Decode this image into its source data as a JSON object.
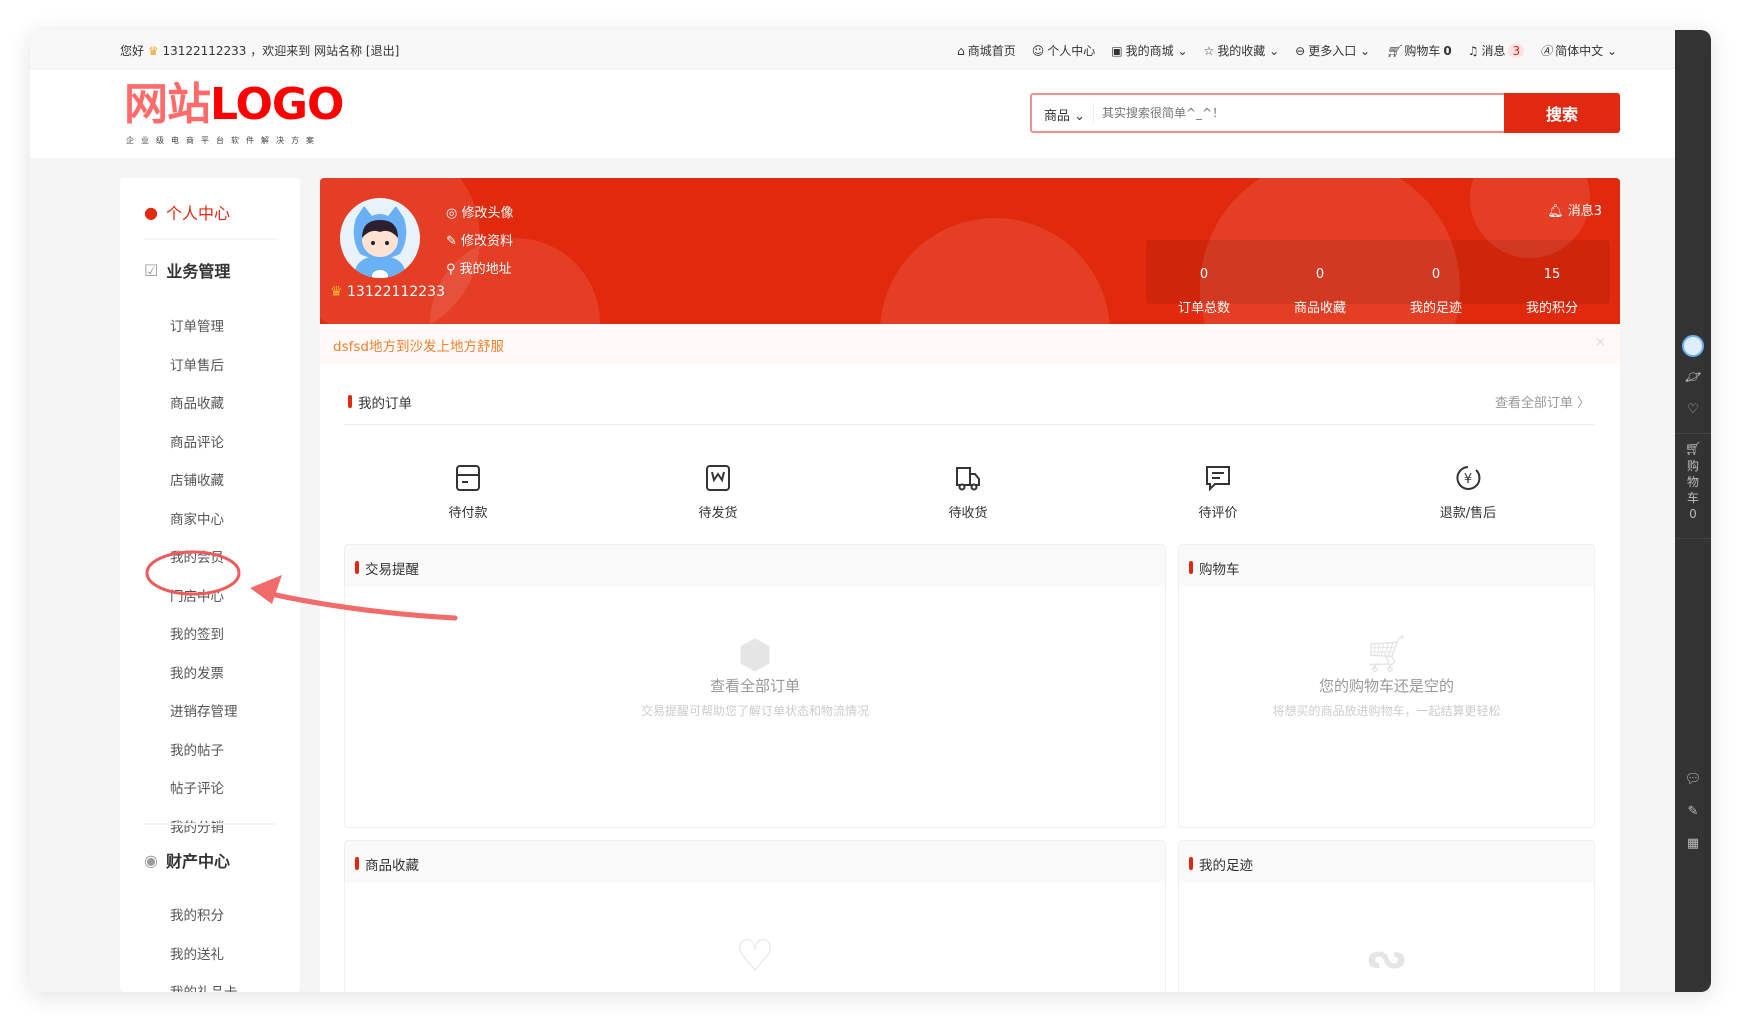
{
  "topbar": {
    "greeting": "您好",
    "user": "13122112233",
    "welcome": "，欢迎来到 网站名称",
    "logout": "[退出]",
    "links": [
      {
        "icon": "home-icon",
        "label": "商城首页"
      },
      {
        "icon": "user-icon",
        "label": "个人中心"
      },
      {
        "icon": "shop-icon",
        "label": "我的商城 ⌄"
      },
      {
        "icon": "star-icon",
        "label": "我的收藏 ⌄"
      },
      {
        "icon": "more-icon",
        "label": "更多入口 ⌄"
      },
      {
        "icon": "cart-icon",
        "label": "购物车"
      },
      {
        "icon": "bell-icon",
        "label": "消息"
      },
      {
        "icon": "language-icon",
        "label": "简体中文 ⌄"
      }
    ],
    "cart_count": "0",
    "msg_count": "3"
  },
  "header": {
    "logo_a": "网站",
    "logo_b": "LOGO",
    "slogan": "企业级电商平台软件解决方案",
    "search_category": "商品 ⌄",
    "search_placeholder": "其实搜索很简单^_^！",
    "search_button": "搜索"
  },
  "dock": {
    "cart": "购物车",
    "cart_count": "0"
  },
  "sidebar": {
    "personal": "个人中心",
    "business": "业务管理",
    "business_items": [
      "订单管理",
      "订单售后",
      "商品收藏",
      "商品评论",
      "店铺收藏",
      "商家中心",
      "我的会员",
      "门店中心",
      "我的签到",
      "我的发票",
      "进销存管理",
      "我的帖子",
      "帖子评论",
      "我的分销"
    ],
    "assets": "财产中心",
    "asset_items": [
      "我的积分",
      "我的送礼",
      "我的礼品卡"
    ]
  },
  "banner": {
    "links": [
      "修改头像",
      "修改资料",
      "我的地址"
    ],
    "username": "13122112233",
    "message": "消息3",
    "stats": [
      {
        "value": "0",
        "label": "订单总数"
      },
      {
        "value": "0",
        "label": "商品收藏"
      },
      {
        "value": "0",
        "label": "我的足迹"
      },
      {
        "value": "15",
        "label": "我的积分"
      }
    ]
  },
  "notice": {
    "text": "dsfsd地方到沙发上地方舒服",
    "close": "×"
  },
  "orders": {
    "title": "我的订单",
    "view_all": "查看全部订单 〉",
    "items": [
      "待付款",
      "待发货",
      "待收货",
      "待评价",
      "退款/售后"
    ]
  },
  "cards": {
    "trade": {
      "title": "交易提醒",
      "empty_title": "查看全部订单",
      "empty_sub": "交易提醒可帮助您了解订单状态和物流情况"
    },
    "cart": {
      "title": "购物车",
      "empty_title": "您的购物车还是空的",
      "empty_sub": "将想买的商品放进购物车，一起结算更轻松"
    },
    "fav": {
      "title": "商品收藏"
    },
    "track": {
      "title": "我的足迹"
    }
  },
  "colors": {
    "accent": "#e0290f",
    "notice": "#f08030"
  }
}
